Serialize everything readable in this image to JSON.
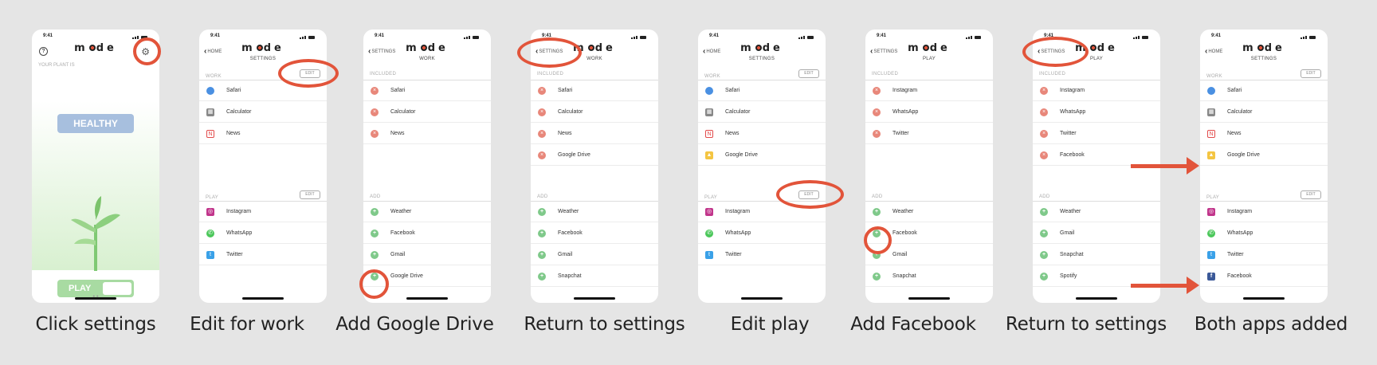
{
  "captions": [
    "Click settings",
    "Edit for work",
    "Add Google Drive",
    "Return to settings",
    "Edit play",
    "Add Facebook",
    "Return to settings",
    "Both apps added"
  ],
  "status_time": "9:41",
  "logo": "mode",
  "home": {
    "plant_label": "YOUR PLANT IS",
    "status": "HEALTHY",
    "play": "PLAY",
    "page_dots": "● ●",
    "help_icon": "?",
    "settings_icon": "⚙"
  },
  "labels": {
    "work": "WORK",
    "play": "PLAY",
    "included": "INCLUDED",
    "add": "ADD",
    "edit": "EDIT",
    "home": "HOME",
    "settings": "SETTINGS",
    "sub_settings": "SETTINGS",
    "sub_work": "WORK",
    "sub_play": "PLAY"
  },
  "icons": {
    "remove": "×",
    "add": "+",
    "news": "N",
    "calc": "▦",
    "drive": "▲",
    "insta": "◎",
    "whats": "✆",
    "twitter": "t",
    "fb": "f"
  },
  "apps": {
    "safari": "Safari",
    "calculator": "Calculator",
    "news": "News",
    "google_drive": "Google Drive",
    "instagram": "Instagram",
    "whatsapp": "WhatsApp",
    "twitter": "Twitter",
    "facebook": "Facebook",
    "weather": "Weather",
    "gmail": "Gmail",
    "snapchat": "Snapchat",
    "spotify": "Spotify"
  },
  "accent": "#e2543a"
}
